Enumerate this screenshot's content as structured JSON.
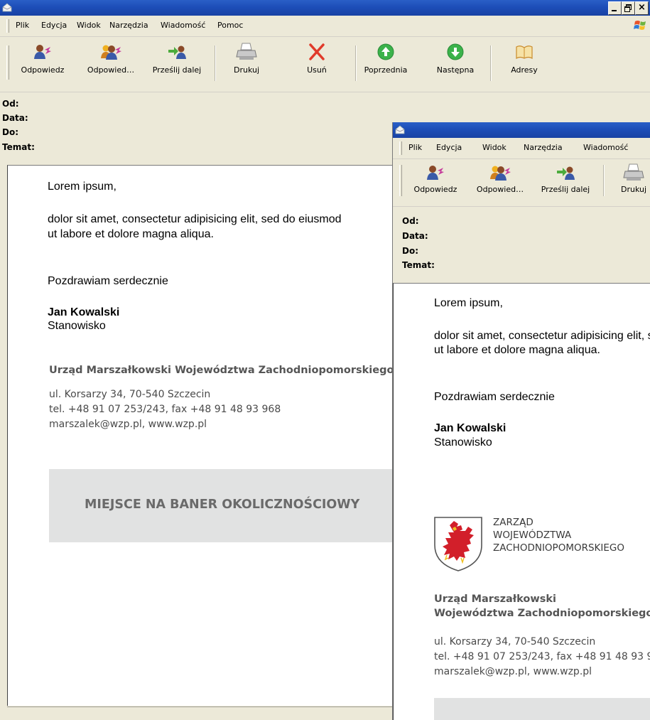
{
  "menu": [
    "Plik",
    "Edycja",
    "Widok",
    "Narzędzia",
    "Wiadomość",
    "Pomoc"
  ],
  "toolbar": {
    "reply": "Odpowiedz",
    "reply_all": "Odpowied…",
    "forward": "Prześlij dalej",
    "print": "Drukuj",
    "delete": "Usuń",
    "previous": "Poprzednia",
    "next": "Następna",
    "addresses": "Adresy"
  },
  "headers": {
    "from": "Od:",
    "date": "Data:",
    "to": "Do:",
    "subject": "Temat:"
  },
  "message": {
    "greeting": "Lorem ipsum,",
    "body_line1": "dolor sit amet, consectetur adipisicing elit, sed do eiusmod",
    "body_line2": "ut labore et dolore magna aliqua.",
    "closing": "Pozdrawiam serdecznie",
    "name": "Jan Kowalski",
    "position": "Stanowisko"
  },
  "signature": {
    "org_full": "Urząd Marszałkowski Województwa Zachodniopomorskiego",
    "org_line1": "Urząd Marszałkowski",
    "org_line2": "Województwa Zachodniopomorskiego",
    "address": "ul. Korsarzy 34, 70-540 Szczecin",
    "phone": "tel. +48 91 07 253/243, fax +48 91 48 93 968",
    "email_web": "marszalek@wzp.pl, www.wzp.pl",
    "banner": "MIEJSCE NA BANER OKOLICZNOŚCIOWY"
  },
  "logo": {
    "line1": "ZARZĄD",
    "line2": "WOJEWÓDZTWA",
    "line3": "ZACHODNIOPOMORSKIEGO"
  },
  "colors": {
    "titlebar": "#1d4eb8",
    "chrome": "#ece9d8",
    "signature_text": "#555555",
    "banner_bg": "#e1e2e2",
    "griffin": "#d21f2a"
  }
}
